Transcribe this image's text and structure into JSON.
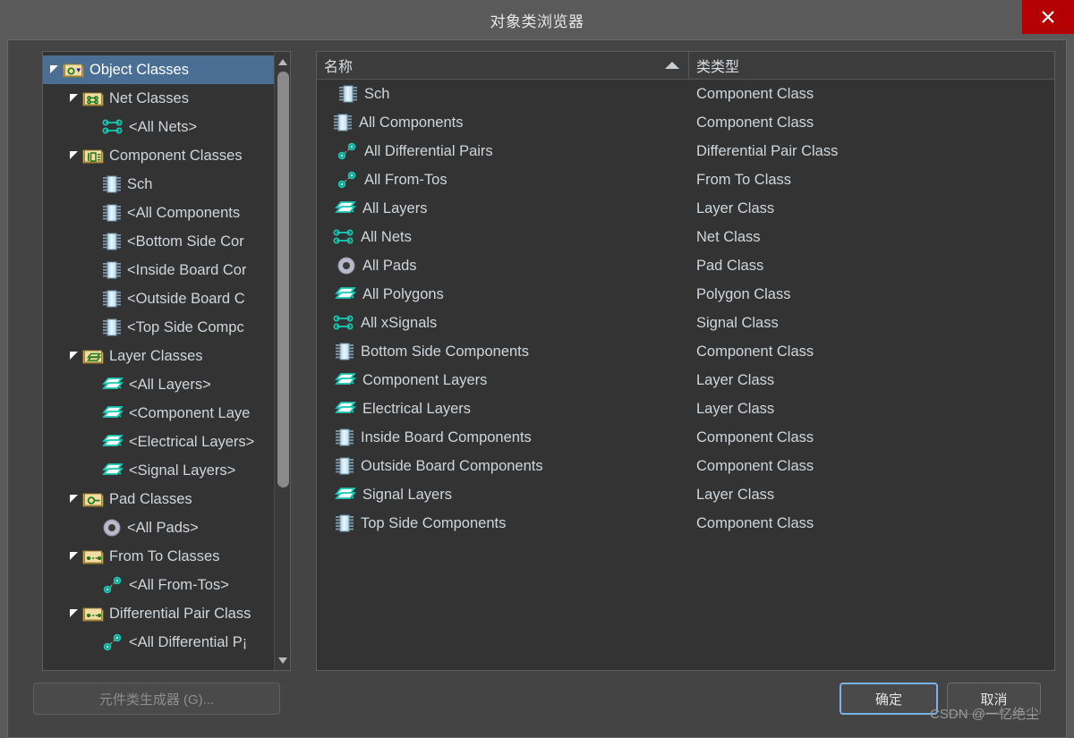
{
  "window": {
    "title": "对象类浏览器",
    "close_label": "×"
  },
  "tree": {
    "items": [
      {
        "label": "Object Classes",
        "icon": "folder-object-classes-icon",
        "depth": 0,
        "twisty": "open",
        "selected": true
      },
      {
        "label": "Net Classes",
        "icon": "folder-net-icon",
        "depth": 1,
        "twisty": "open",
        "selected": false
      },
      {
        "label": "<All Nets>",
        "icon": "net-icon",
        "depth": 2,
        "twisty": "none",
        "selected": false
      },
      {
        "label": "Component Classes",
        "icon": "folder-component-icon",
        "depth": 1,
        "twisty": "open",
        "selected": false
      },
      {
        "label": "Sch",
        "icon": "component-icon",
        "depth": 2,
        "twisty": "none",
        "selected": false
      },
      {
        "label": "<All Components",
        "icon": "component-icon",
        "depth": 2,
        "twisty": "none",
        "selected": false
      },
      {
        "label": "<Bottom Side Cor",
        "icon": "component-icon",
        "depth": 2,
        "twisty": "none",
        "selected": false
      },
      {
        "label": "<Inside Board Cor",
        "icon": "component-icon",
        "depth": 2,
        "twisty": "none",
        "selected": false
      },
      {
        "label": "<Outside Board C",
        "icon": "component-icon",
        "depth": 2,
        "twisty": "none",
        "selected": false
      },
      {
        "label": "<Top Side Compc",
        "icon": "component-icon",
        "depth": 2,
        "twisty": "none",
        "selected": false
      },
      {
        "label": "Layer Classes",
        "icon": "folder-layer-icon",
        "depth": 1,
        "twisty": "open",
        "selected": false
      },
      {
        "label": "<All Layers>",
        "icon": "layer-icon",
        "depth": 2,
        "twisty": "none",
        "selected": false
      },
      {
        "label": "<Component Laye",
        "icon": "layer-icon",
        "depth": 2,
        "twisty": "none",
        "selected": false
      },
      {
        "label": "<Electrical Layers>",
        "icon": "layer-icon",
        "depth": 2,
        "twisty": "none",
        "selected": false
      },
      {
        "label": "<Signal Layers>",
        "icon": "layer-icon",
        "depth": 2,
        "twisty": "none",
        "selected": false
      },
      {
        "label": "Pad Classes",
        "icon": "folder-pad-icon",
        "depth": 1,
        "twisty": "open",
        "selected": false
      },
      {
        "label": "<All Pads>",
        "icon": "pad-icon",
        "depth": 2,
        "twisty": "none",
        "selected": false
      },
      {
        "label": "From To Classes",
        "icon": "folder-fromto-icon",
        "depth": 1,
        "twisty": "open",
        "selected": false
      },
      {
        "label": "<All From-Tos>",
        "icon": "fromto-icon",
        "depth": 2,
        "twisty": "none",
        "selected": false
      },
      {
        "label": "Differential Pair Class",
        "icon": "folder-diffpair-icon",
        "depth": 1,
        "twisty": "open",
        "selected": false
      },
      {
        "label": "<All Differential P¡",
        "icon": "diffpair-icon",
        "depth": 2,
        "twisty": "none",
        "selected": false
      }
    ],
    "scrollbar": {
      "up_arrow": "scroll-up-icon",
      "down_arrow": "scroll-down-icon"
    }
  },
  "list": {
    "columns": [
      {
        "label": "名称",
        "sort": "asc"
      },
      {
        "label": "类类型",
        "sort": "none"
      }
    ],
    "rows": [
      {
        "name": "Sch",
        "type": "Component Class",
        "icon": "component-icon",
        "indent": 24
      },
      {
        "name": "All Components",
        "type": "Component Class",
        "icon": "component-icon",
        "indent": 18
      },
      {
        "name": "All Differential Pairs",
        "type": "Differential Pair Class",
        "icon": "diffpair-icon",
        "indent": 22
      },
      {
        "name": "All From-Tos",
        "type": "From To Class",
        "icon": "fromto-icon",
        "indent": 22
      },
      {
        "name": "All Layers",
        "type": "Layer Class",
        "icon": "layer-icon",
        "indent": 20
      },
      {
        "name": "All Nets",
        "type": "Net Class",
        "icon": "net-icon",
        "indent": 18
      },
      {
        "name": "All Pads",
        "type": "Pad Class",
        "icon": "pad-icon",
        "indent": 22
      },
      {
        "name": "All Polygons",
        "type": "Polygon Class",
        "icon": "layer-icon",
        "indent": 20
      },
      {
        "name": "All xSignals",
        "type": "Signal Class",
        "icon": "net-icon",
        "indent": 18
      },
      {
        "name": "Bottom Side Components",
        "type": "Component Class",
        "icon": "component-icon",
        "indent": 20
      },
      {
        "name": "Component Layers",
        "type": "Layer Class",
        "icon": "layer-icon",
        "indent": 20
      },
      {
        "name": "Electrical Layers",
        "type": "Layer Class",
        "icon": "layer-icon",
        "indent": 20
      },
      {
        "name": "Inside Board Components",
        "type": "Component Class",
        "icon": "component-icon",
        "indent": 20
      },
      {
        "name": "Outside Board Components",
        "type": "Component Class",
        "icon": "component-icon",
        "indent": 20
      },
      {
        "name": "Signal Layers",
        "type": "Layer Class",
        "icon": "layer-icon",
        "indent": 20
      },
      {
        "name": "Top Side Components",
        "type": "Component Class",
        "icon": "component-icon",
        "indent": 20
      }
    ]
  },
  "footer": {
    "generator_label": "元件类生成器 (G)...",
    "ok_label": "确定",
    "cancel_label": "取消",
    "watermark": "CSDN @一忆绝尘"
  },
  "colors": {
    "window_frame": "#5a5a5a",
    "dialog_body": "#444444",
    "panel_bg": "#333333",
    "text": "#cfd6db",
    "selection": "#4a6e94",
    "close_red": "#b50000",
    "focus_border": "#79b1e8",
    "icon_teal": "#19c8b4",
    "folder_gold": "#e2bd63"
  }
}
